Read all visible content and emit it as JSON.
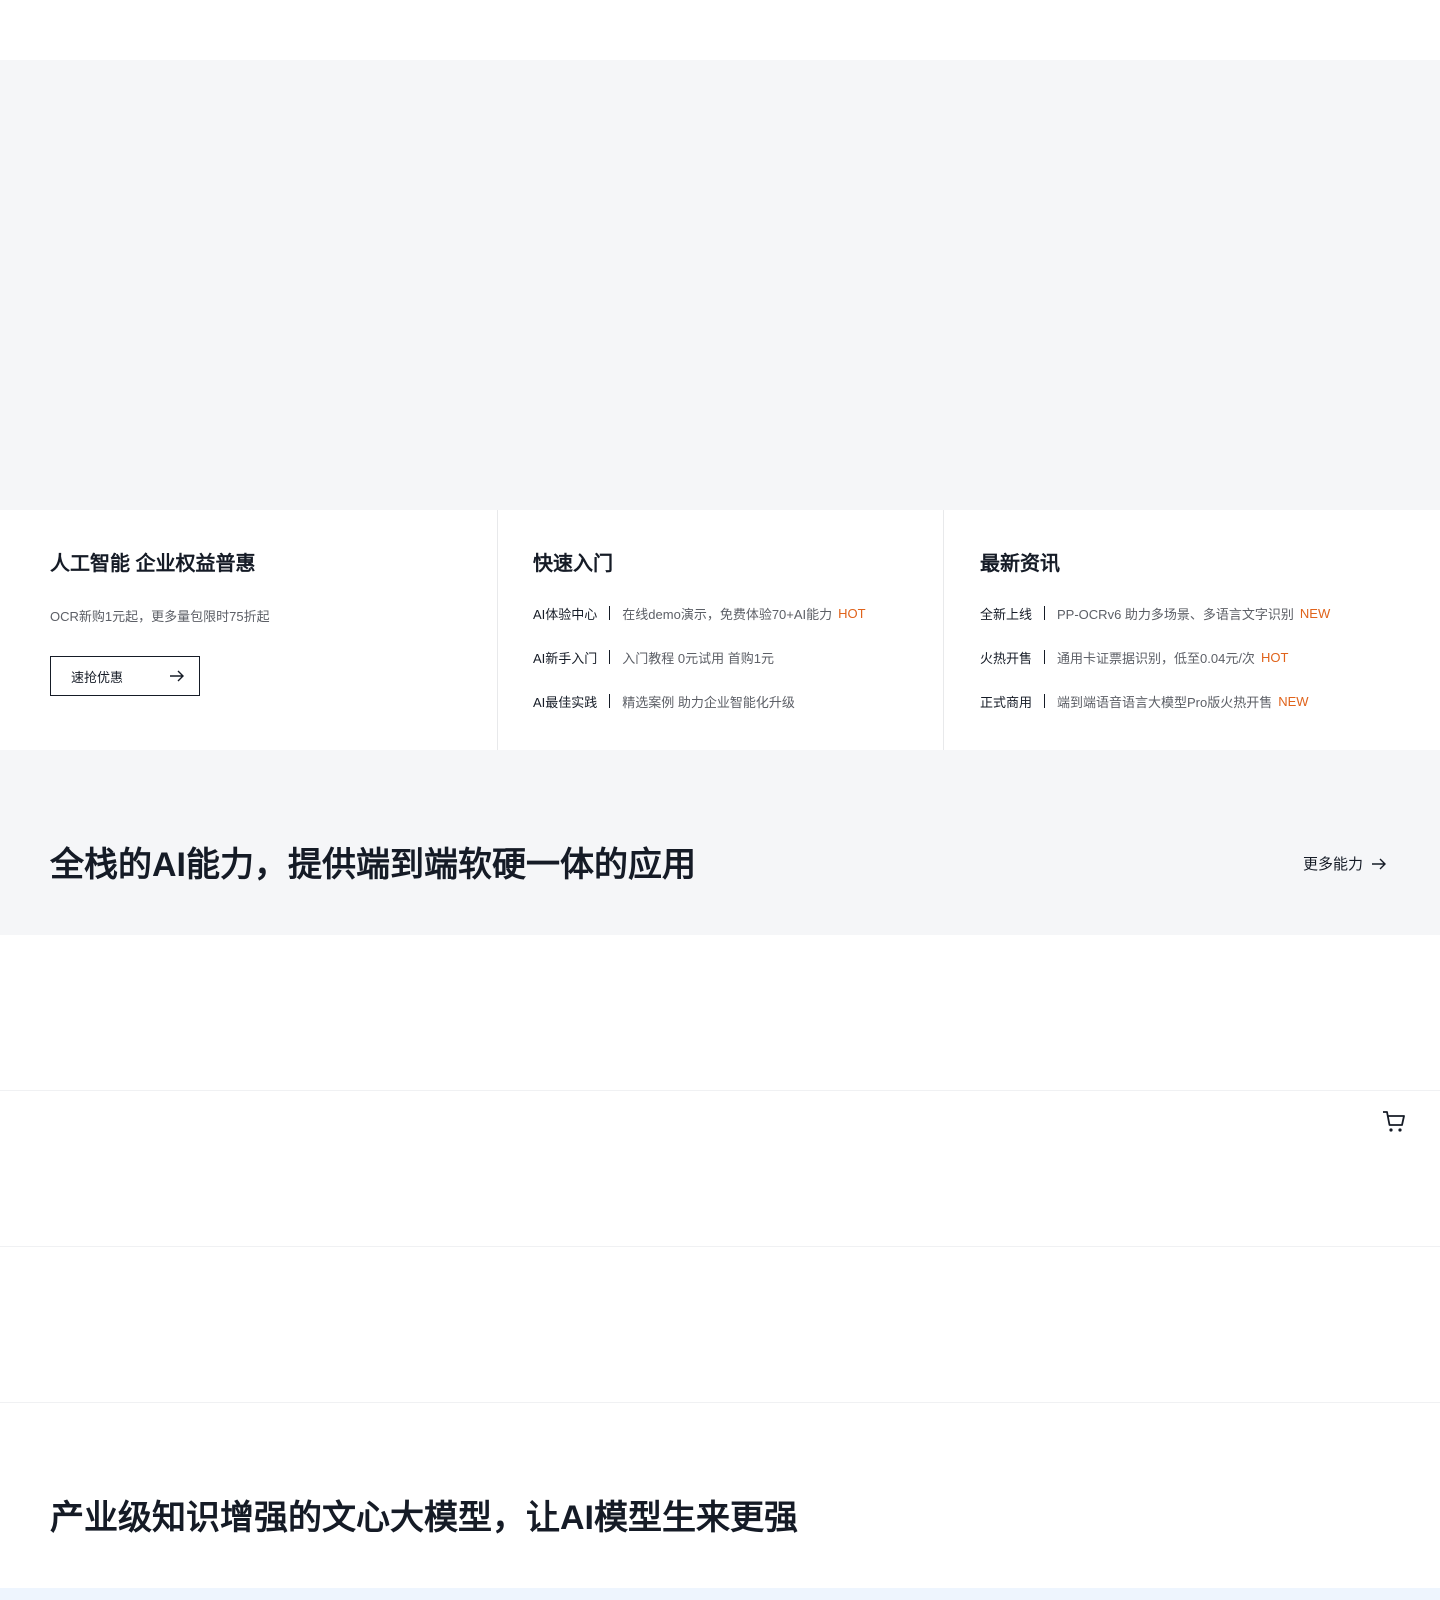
{
  "promo": {
    "benefit": {
      "title": "人工智能 企业权益普惠",
      "desc": "OCR新购1元起，更多量包限时75折起",
      "button_label": "速抢优惠"
    },
    "quickstart": {
      "title": "快速入门",
      "items": [
        {
          "key": "AI体验中心",
          "text": "在线demo演示，免费体验70+AI能力",
          "tag": "HOT"
        },
        {
          "key": "AI新手入门",
          "text": "入门教程 0元试用 首购1元",
          "tag": ""
        },
        {
          "key": "AI最佳实践",
          "text": "精选案例 助力企业智能化升级",
          "tag": ""
        }
      ]
    },
    "news": {
      "title": "最新资讯",
      "items": [
        {
          "key": "全新上线",
          "text": "PP-OCRv6 助力多场景、多语言文字识别",
          "tag": "NEW"
        },
        {
          "key": "火热开售",
          "text": "通用卡证票据识别，低至0.04元/次",
          "tag": "HOT"
        },
        {
          "key": "正式商用",
          "text": "端到端语音语言大模型Pro版火热开售",
          "tag": "NEW"
        }
      ]
    }
  },
  "ability": {
    "title": "全栈的AI能力，提供端到端软硬一体的应用",
    "more_label": "更多能力"
  },
  "model": {
    "title": "产业级知识增强的文心大模型，让AI模型生来更强"
  },
  "icons": {
    "arrow": "arrow-right-icon",
    "cart": "cart-icon"
  },
  "colors": {
    "accent_tag": "#e0631b",
    "band_bg": "#f5f6f8",
    "text_primary": "#151b26"
  }
}
